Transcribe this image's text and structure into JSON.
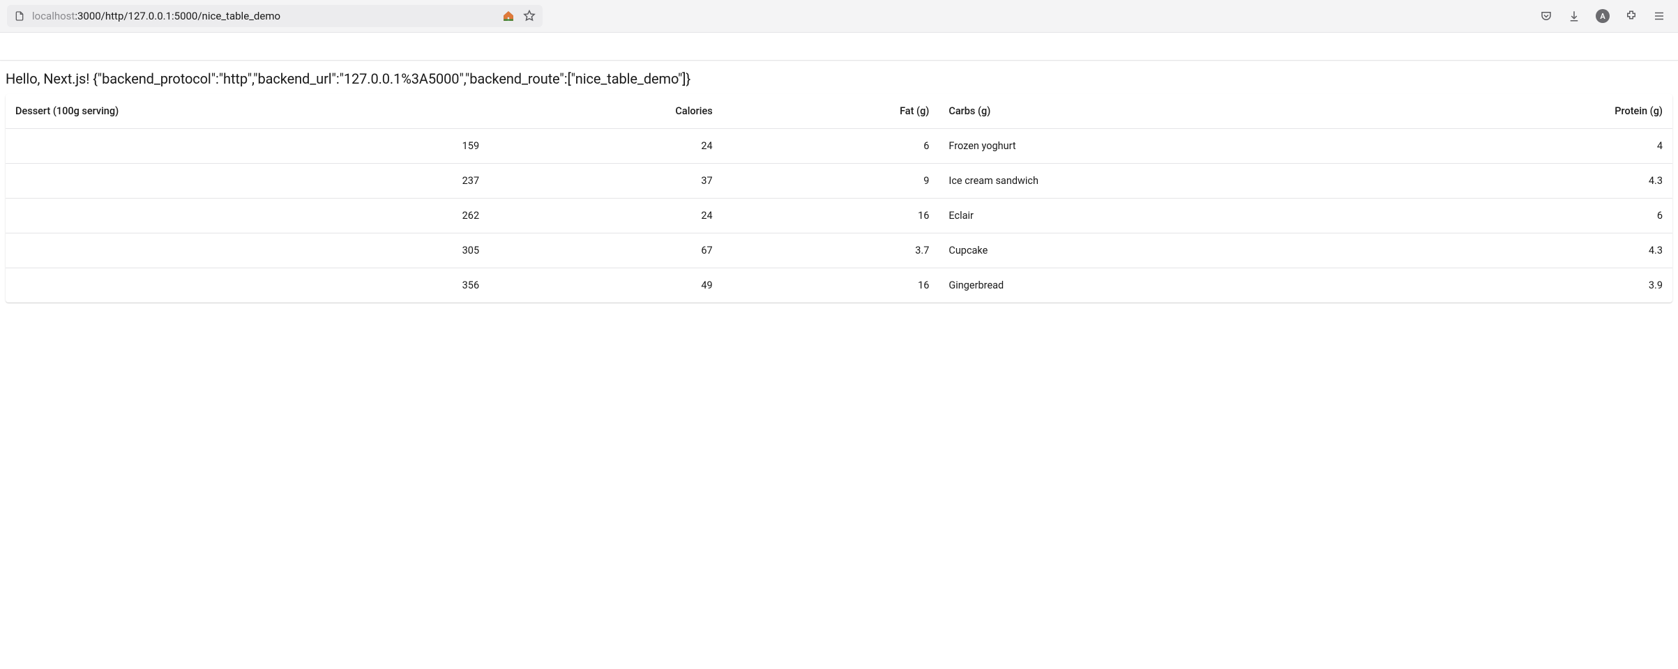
{
  "browser": {
    "url_prefix_grey": "localhost",
    "url_rest": ":3000/http/127.0.0.1:5000/nice_table_demo",
    "account_letter": "A"
  },
  "greeting": "Hello, Next.js! {\"backend_protocol\":\"http\",\"backend_url\":\"127.0.0.1%3A5000\",\"backend_route\":[\"nice_table_demo\"]}",
  "table": {
    "headers": {
      "dessert": "Dessert (100g serving)",
      "calories": "Calories",
      "fat": "Fat (g)",
      "carbs": "Carbs (g)",
      "protein": "Protein (g)"
    },
    "rows": [
      {
        "calories": "159",
        "fat": "24",
        "carbs": "6",
        "name": "Frozen yoghurt",
        "protein": "4"
      },
      {
        "calories": "237",
        "fat": "37",
        "carbs": "9",
        "name": "Ice cream sandwich",
        "protein": "4.3"
      },
      {
        "calories": "262",
        "fat": "24",
        "carbs": "16",
        "name": "Eclair",
        "protein": "6"
      },
      {
        "calories": "305",
        "fat": "67",
        "carbs": "3.7",
        "name": "Cupcake",
        "protein": "4.3"
      },
      {
        "calories": "356",
        "fat": "49",
        "carbs": "16",
        "name": "Gingerbread",
        "protein": "3.9"
      }
    ]
  }
}
